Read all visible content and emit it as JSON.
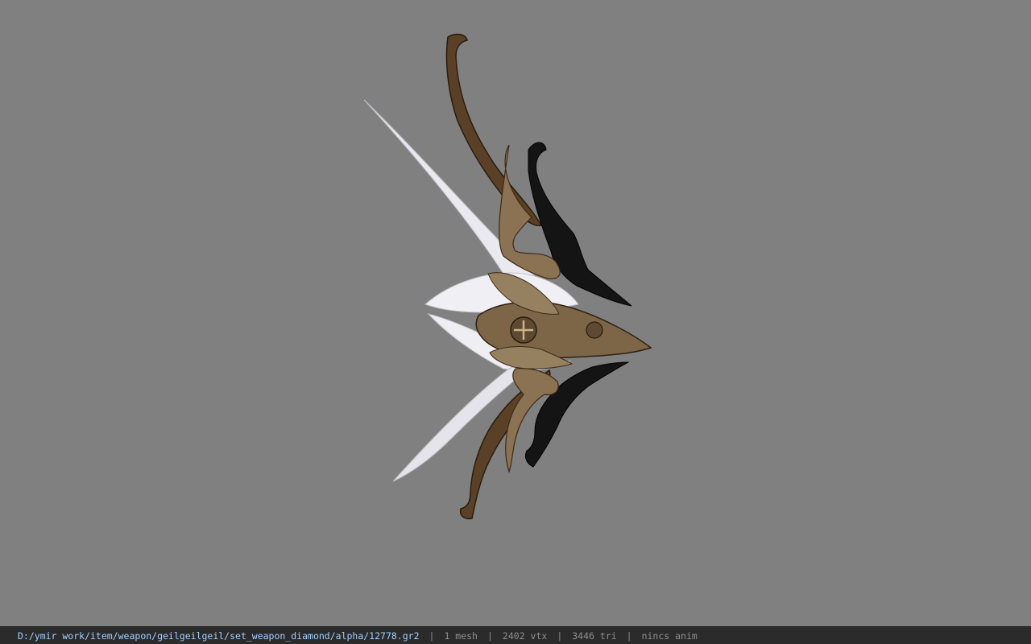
{
  "colors": {
    "background": "#808080",
    "statusbar_bg": "#2b2b2b",
    "path_text": "#9fd0ff",
    "stat_text": "#8f8f8f",
    "bow_dark": "#1a1a1a",
    "bow_bronze": "#8a7150",
    "bow_white": "#e8e8ee"
  },
  "viewport": {
    "icon": "model-preview"
  },
  "statusbar": {
    "path": "D:/ymir work/item/weapon/geilgeilgeil/set_weapon_diamond/alpha/12778.gr2",
    "separator": "|",
    "mesh": "1 mesh",
    "vertices": "2402 vtx",
    "triangles": "3446 tri",
    "anim": "nincs anim"
  }
}
